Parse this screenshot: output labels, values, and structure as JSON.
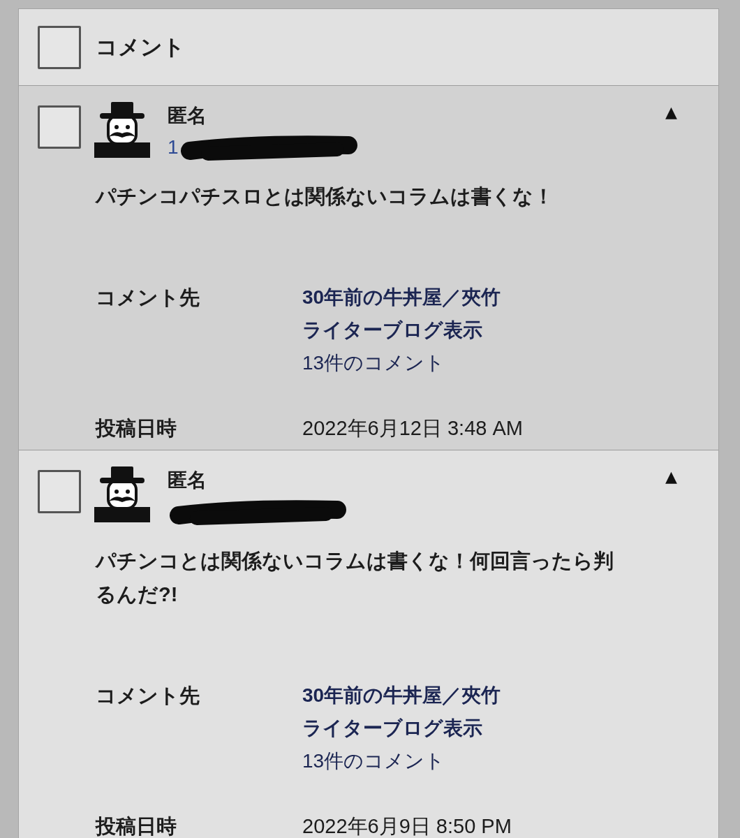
{
  "header": {
    "checkbox": {
      "checked": false
    },
    "title": "コメント"
  },
  "comments": [
    {
      "highlighted": true,
      "checked": false,
      "author": "匿名",
      "author_link": "1",
      "redacted": true,
      "toggle": "▲",
      "text": "パチンコパチスロとは関係ないコラムは書くな！",
      "in_response_to": {
        "label": "コメント先",
        "post_title": "30年前の牛丼屋／夾竹",
        "blog_link": "ライターブログ表示",
        "comment_count": "13件のコメント"
      },
      "submitted": {
        "label": "投稿日時",
        "date": "2022年6月12日 3:48 AM"
      }
    },
    {
      "highlighted": false,
      "checked": false,
      "author": "匿名",
      "redacted": true,
      "toggle": "▲",
      "text": "パチンコとは関係ないコラムは書くな！何回言ったら判るんだ?!",
      "in_response_to": {
        "label": "コメント先",
        "post_title": "30年前の牛丼屋／夾竹",
        "blog_link": "ライターブログ表示",
        "comment_count": "13件のコメント"
      },
      "submitted": {
        "label": "投稿日時",
        "date": "2022年6月9日 8:50 PM"
      }
    }
  ]
}
